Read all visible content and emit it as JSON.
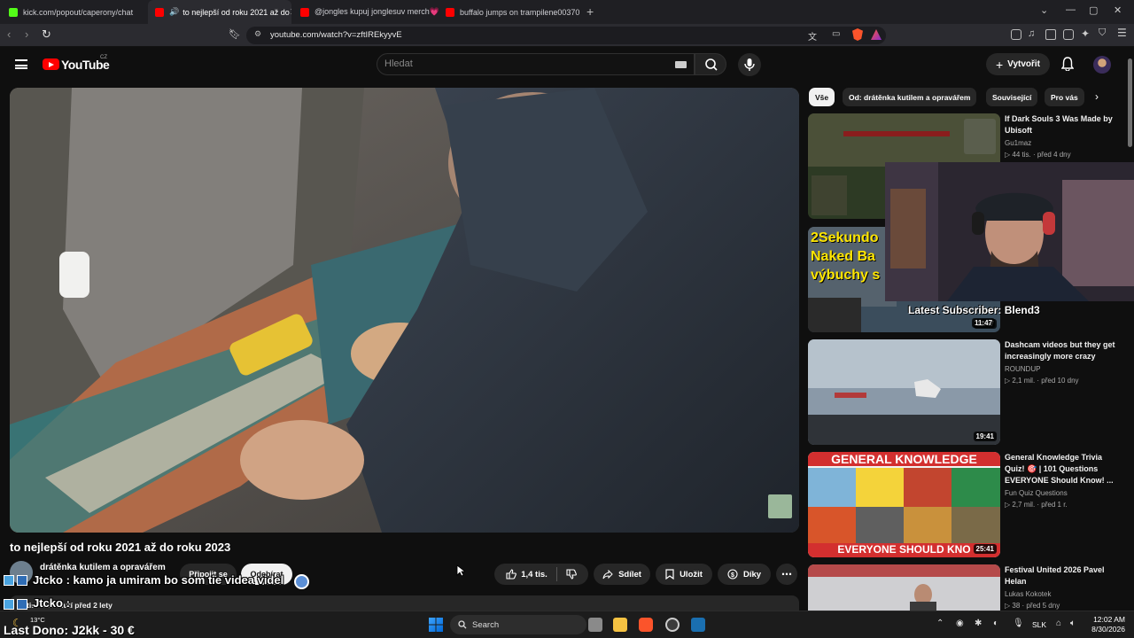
{
  "browser": {
    "tabs": [
      {
        "title": "kick.com/popout/caperony/chat",
        "favicon_color": "#53fc18"
      },
      {
        "title": "to nejlepší od roku 2021 až do",
        "favicon_color": "#ff0000",
        "active": true
      },
      {
        "title": "@jongles kupuj jonglesuv merch💗",
        "favicon_color": "#ff0000"
      },
      {
        "title": "buffalo jumps on trampilene00370 -",
        "favicon_color": "#ff0000"
      }
    ],
    "url": "youtube.com/watch?v=zftIREkyyvE"
  },
  "youtube": {
    "logo_text": "YouTube",
    "country": "CZ",
    "search_placeholder": "Hledat",
    "create_label": "Vytvořit"
  },
  "video": {
    "title": "to nejlepší od roku 2021 až do roku 2023",
    "channel": "drátěnka kutilem a opravářem",
    "join_label": "Připojit se",
    "subscribe_label": "Odebírat",
    "like_count": "1,4 tis.",
    "share_label": "Sdílet",
    "save_label": "Uložit",
    "thanks_label": "Díky",
    "desc_meta": "tis. zhlédnutí   před 2 lety"
  },
  "sidebar": {
    "chips": [
      "Vše",
      "Od: drátěnka kutilem a opravářem",
      "Související",
      "Pro vás"
    ],
    "recommendations": [
      {
        "title": "If Dark Souls 3 Was Made by Ubisoft",
        "channel": "Gu1maz",
        "views": "44 tis.",
        "age": "před 4 dny",
        "duration": "",
        "thumb": "darksouls"
      },
      {
        "title": "",
        "channel": "",
        "views": "",
        "age": "",
        "duration": "11:47",
        "thumb": "2sekundy",
        "thumb_text": "2Sekundo Naked Ba výbuchy s"
      },
      {
        "title": "Dashcam videos but they get increasingly more crazy",
        "channel": "ROUNDUP",
        "views": "2,1 mil.",
        "age": "před 10 dny",
        "duration": "19:41",
        "thumb": "dashcam"
      },
      {
        "title": "General Knowledge Trivia Quiz! 🎯 | 101 Questions EVERYONE Should Know! ...",
        "channel": "Fun Quiz Questions",
        "views": "2,7 mil.",
        "age": "před 1 r.",
        "duration": "25:41",
        "thumb": "quiz",
        "thumb_top": "GENERAL KNOWLEDGE",
        "thumb_bottom": "EVERYONE SHOULD KNO"
      },
      {
        "title": "Festival United 2026 Pavel Helan",
        "channel": "Lukas Kokotek",
        "views": "38",
        "age": "před 5 dny",
        "duration": "",
        "thumb": "festival"
      }
    ]
  },
  "overlay": {
    "chat1": "Jtcko : kamo ja umiram bo som tie videa videl",
    "chat2": "Jtcko :",
    "latest_subscriber": "Latest Subscriber: Blend3",
    "last_dono": "Last Dono: J2kk - 30 €"
  },
  "taskbar": {
    "search": "Search",
    "weather": "13°C",
    "language": "SLK",
    "time": "12:02 AM",
    "date": "8/30/2026"
  }
}
